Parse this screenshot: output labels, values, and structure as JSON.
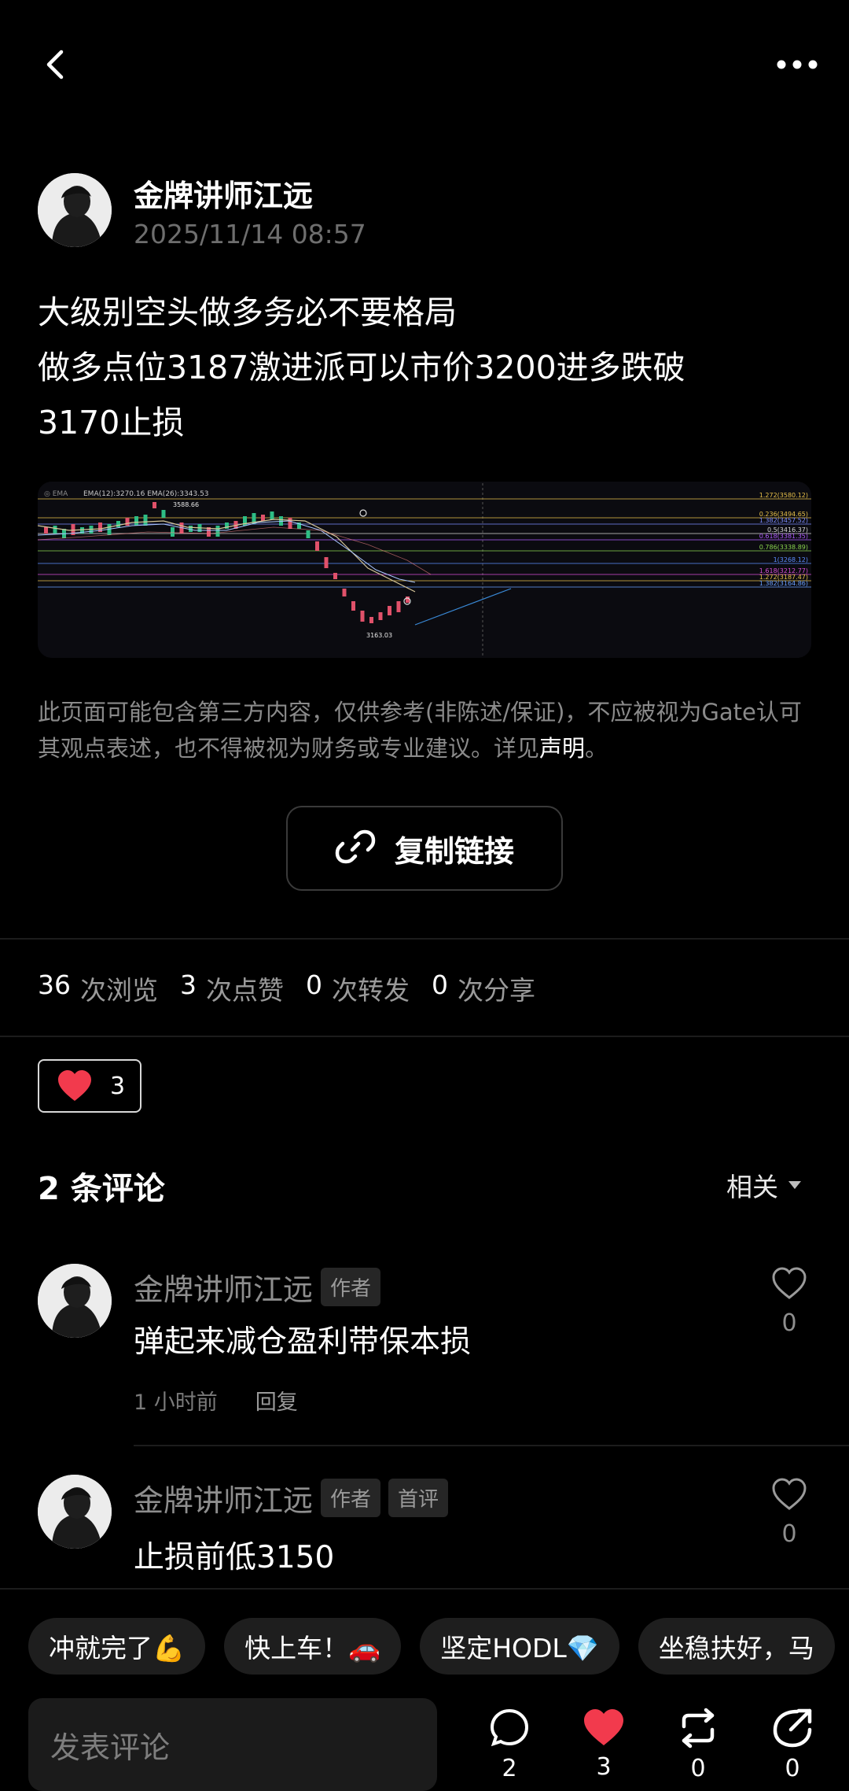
{
  "post": {
    "author": "金牌讲师江远",
    "time": "2025/11/14 08:57",
    "lines": [
      "大级别空头做多务必不要格局",
      "做多点位3187激进派可以市价3200进多跌破",
      "3170止损"
    ]
  },
  "chart_image": {
    "legend": "EMA(12):3270.16 EMA(26):3343.53",
    "high_label": "3588.66",
    "low_label": "3163.03",
    "fib_levels": [
      {
        "label": "1.272(3580.12)",
        "color": "#e8c14a"
      },
      {
        "label": "0.236(3494.65)",
        "color": "#e8c14a"
      },
      {
        "label": "1.382(3457.52)",
        "color": "#7b8cff"
      },
      {
        "label": "0.5(3416.37)",
        "color": "#d7d7d7"
      },
      {
        "label": "0.618(3381.35)",
        "color": "#b05cff"
      },
      {
        "label": "0.786(3338.89)",
        "color": "#8bd64f"
      },
      {
        "label": "1(3268.12)",
        "color": "#5b8dff"
      },
      {
        "label": "1.618(3212.77)",
        "color": "#d94fd9"
      },
      {
        "label": "1.272(3187.47)",
        "color": "#e8c14a"
      },
      {
        "label": "1.382(3164.86)",
        "color": "#6aa0ff"
      }
    ]
  },
  "disclaimer": {
    "text": "此页面可能包含第三方内容，仅供参考(非陈述/保证)，不应被视为Gate认可其观点表述，也不得被视为财务或专业建议。详见",
    "link": "声明",
    "end": "。"
  },
  "copy_link_label": "复制链接",
  "stats": [
    {
      "num": "36",
      "label": "次浏览"
    },
    {
      "num": "3",
      "label": "次点赞"
    },
    {
      "num": "0",
      "label": "次转发"
    },
    {
      "num": "0",
      "label": "次分享"
    }
  ],
  "like_chip_count": "3",
  "comments": {
    "title": "2 条评论",
    "sort_label": "相关",
    "items": [
      {
        "name": "金牌讲师江远",
        "tags": [
          "作者"
        ],
        "text": "弹起来减仓盈利带保本损",
        "time": "1 小时前",
        "reply": "回复",
        "likes": "0"
      },
      {
        "name": "金牌讲师江远",
        "tags": [
          "作者",
          "首评"
        ],
        "text": "止损前低3150",
        "likes": "0"
      }
    ]
  },
  "quick_replies": [
    "冲就完了💪",
    "快上车！🚗",
    "坚定HODL💎",
    "坐稳扶好，马"
  ],
  "input_placeholder": "发表评论",
  "actions": {
    "comment": "2",
    "like": "3",
    "repost": "0",
    "share": "0"
  },
  "colors": {
    "like_red": "#f23a4d",
    "background": "#000000"
  }
}
